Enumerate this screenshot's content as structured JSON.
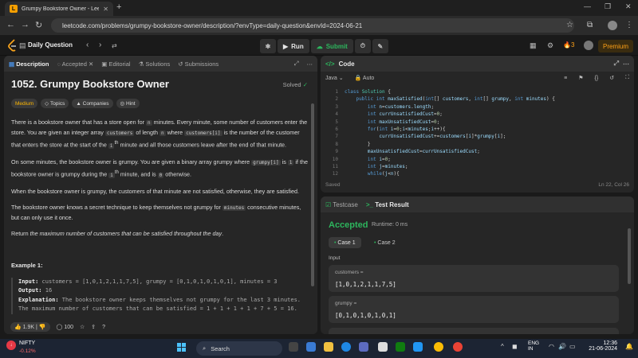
{
  "browser": {
    "tab_title": "Grumpy Bookstore Owner - Lee",
    "url": "leetcode.com/problems/grumpy-bookstore-owner/description/?envType=daily-question&envId=2024-06-21"
  },
  "header": {
    "daily_question": "Daily Question",
    "run_label": "Run",
    "submit_label": "Submit",
    "streak": "3",
    "premium_label": "Premium"
  },
  "left_tabs": [
    "Description",
    "Accepted",
    "Editorial",
    "Solutions",
    "Submissions"
  ],
  "problem": {
    "title": "1052. Grumpy Bookstore Owner",
    "status": "Solved",
    "tags": [
      "Medium",
      "Topics",
      "Companies",
      "Hint"
    ],
    "p1a": "There is a bookstore owner that has a store open for ",
    "p1_n": "n",
    "p1b": " minutes. Every minute, some number of customers enter the store. You are given an integer array ",
    "p1_cust": "customers",
    "p1c": " of length ",
    "p1_n2": "n",
    "p1d": " where ",
    "p1_custi": "customers[i]",
    "p1e": " is the number of the customer that enters the store at the start of the ",
    "p1_ith": "i",
    "p1_th": "th",
    "p1f": " minute and all those customers leave after the end of that minute.",
    "p2a": "On some minutes, the bookstore owner is grumpy. You are given a binary array grumpy where ",
    "p2_grumpyi": "grumpy[i]",
    "p2b": " is ",
    "p2_one": "1",
    "p2c": " if the bookstore owner is grumpy during the ",
    "p2_ith": "i",
    "p2_th": "th",
    "p2d": " minute, and is ",
    "p2_zero": "0",
    "p2e": " otherwise.",
    "p3": "When the bookstore owner is grumpy, the customers of that minute are not satisfied, otherwise, they are satisfied.",
    "p4a": "The bookstore owner knows a secret technique to keep themselves not grumpy for ",
    "p4_minutes": "minutes",
    "p4b": " consecutive minutes, but can only use it once.",
    "p5a": "Return ",
    "p5_em": "the maximum number of customers that can be satisfied throughout the day",
    "p5b": ".",
    "example_title": "Example 1:",
    "ex_input_label": "Input:",
    "ex_input": " customers = [1,0,1,2,1,1,7,5], grumpy = [0,1,0,1,0,1,0,1], minutes = 3",
    "ex_output_label": "Output:",
    "ex_output": " 16",
    "ex_expl_label": "Explanation:",
    "ex_expl": " The bookstore owner keeps themselves not grumpy for the last 3 minutes.",
    "ex_expl2": "The maximum number of customers that can be satisfied = 1 + 1 + 1 + 1 + 7 + 5 = 16."
  },
  "footer": {
    "likes": "1.9K",
    "comments": "100"
  },
  "code_panel": {
    "title": "Code",
    "language": "Java",
    "mode": "Auto",
    "saved": "Saved",
    "cursor": "Ln 22, Col 26",
    "lines": [
      "class Solution {",
      "    public int maxSatisfied(int[] customers, int[] grumpy, int minutes) {",
      "        int n=customers.length;",
      "        int currUnsatisfiedCust=0;",
      "        int maxUnsatisfiedCust=0;",
      "        for(int i=0;i<minutes;i++){",
      "            currUnsatisfiedCust+=customers[i]*grumpy[i];",
      "        }",
      "        maxUnsatisfiedCust=currUnsatisfiedCust;",
      "        int i=0;",
      "        int j=minutes;",
      "        while(j<n){"
    ]
  },
  "test_panel": {
    "tab_testcase": "Testcase",
    "tab_result": "Test Result",
    "verdict": "Accepted",
    "runtime": "Runtime: 0 ms",
    "case1": "Case 1",
    "case2": "Case 2",
    "input_label": "Input",
    "customers_label": "customers =",
    "customers_value": "[1,0,1,2,1,1,7,5]",
    "grumpy_label": "grumpy =",
    "grumpy_value": "[0,1,0,1,0,1,0,1]"
  },
  "taskbar": {
    "stock_name": "NIFTY",
    "stock_change": "-0.12%",
    "search_label": "Search",
    "lang1": "ENG",
    "lang2": "IN",
    "time": "12:36",
    "date": "21-06-2024"
  }
}
